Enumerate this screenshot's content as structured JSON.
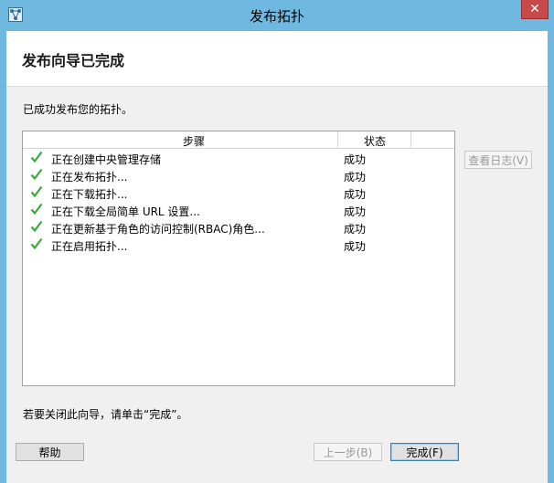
{
  "window": {
    "title": "发布拓扑",
    "close_glyph": "✕"
  },
  "header": {
    "heading": "发布向导已完成"
  },
  "main": {
    "success_message": "已成功发布您的拓扑。",
    "table": {
      "columns": [
        "步骤",
        "状态"
      ],
      "rows": [
        {
          "step": "正在创建中央管理存储",
          "status": "成功"
        },
        {
          "step": "正在发布拓扑...",
          "status": "成功"
        },
        {
          "step": "正在下载拓扑...",
          "status": "成功"
        },
        {
          "step": "正在下载全局简单 URL 设置...",
          "status": "成功"
        },
        {
          "step": "正在更新基于角色的访问控制(RBAC)角色...",
          "status": "成功"
        },
        {
          "step": "正在启用拓扑...",
          "status": "成功"
        }
      ]
    },
    "view_log_label": "查看日志(V)",
    "close_hint": "若要关闭此向导，请单击“完成”。"
  },
  "footer": {
    "help_label": "帮助",
    "back_label": "上一步(B)",
    "finish_label": "完成(F)"
  },
  "colors": {
    "titlebar": "#6fb8e0",
    "close": "#c74949",
    "check": "#3aa83a"
  },
  "icons": {
    "app": "topology-app-icon",
    "row": "green-check-icon"
  }
}
